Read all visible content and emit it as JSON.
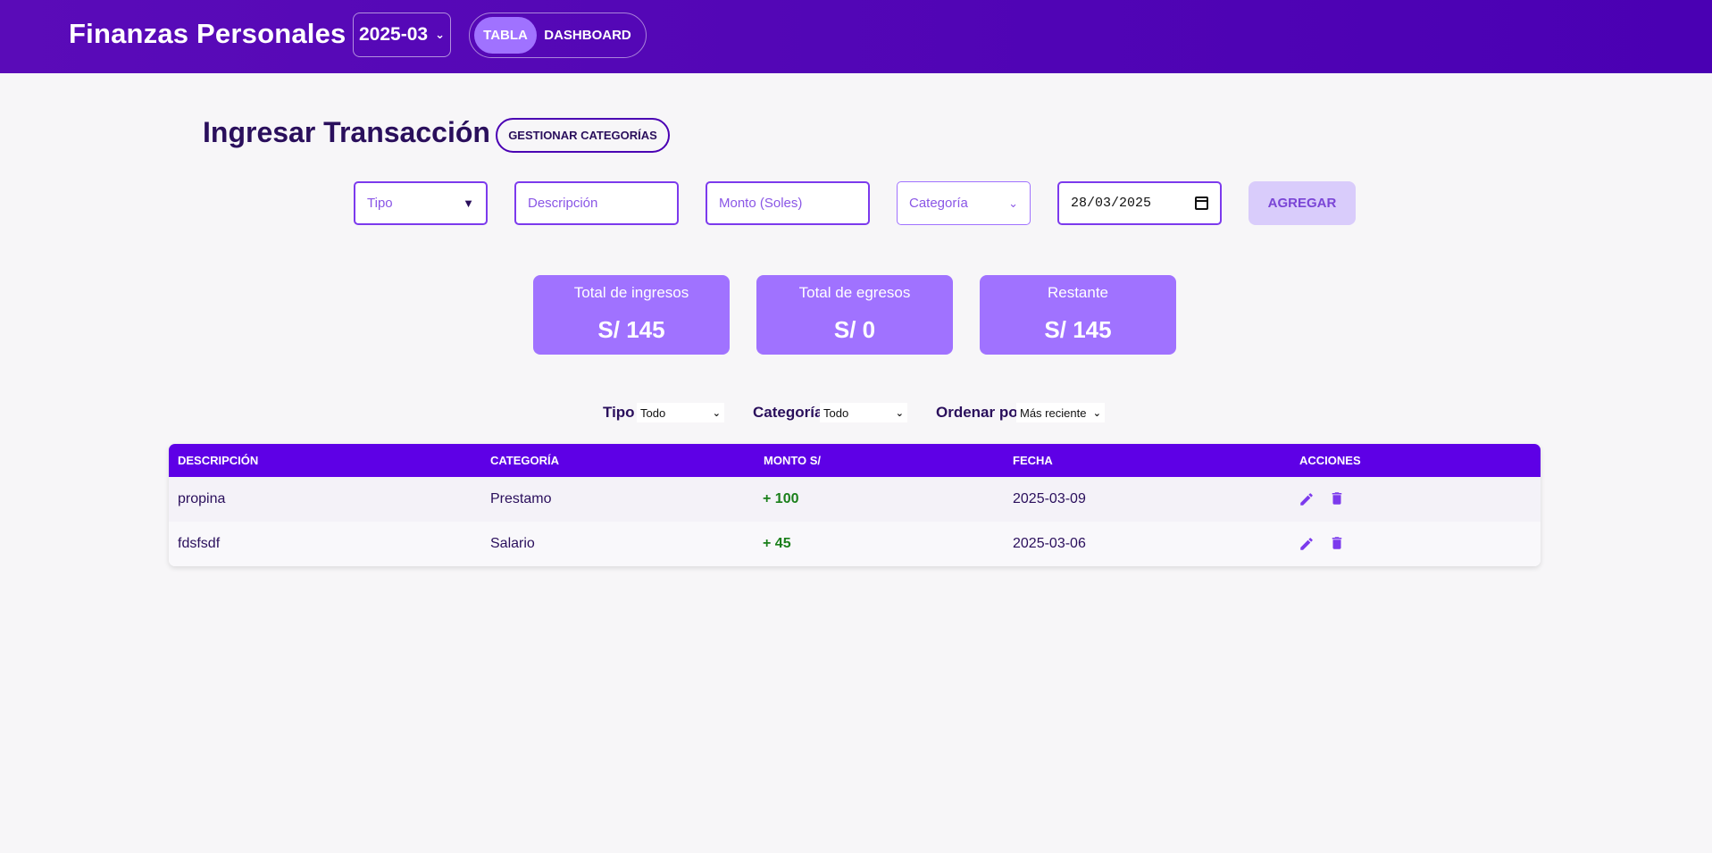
{
  "header": {
    "title": "Finanzas Personales",
    "month": "2025-03",
    "tabs": [
      {
        "label": "TABLA",
        "active": true
      },
      {
        "label": "DASHBOARD",
        "active": false
      }
    ]
  },
  "form": {
    "title": "Ingresar Transacción",
    "manage_categories_label": "GESTIONAR CATEGORÍAS",
    "type_placeholder": "Tipo",
    "description_placeholder": "Descripción",
    "amount_placeholder": "Monto (Soles)",
    "category_placeholder": "Categoría",
    "date_value": "28/03/2025",
    "add_label": "AGREGAR"
  },
  "summary": [
    {
      "label": "Total de ingresos",
      "value": "S/ 145"
    },
    {
      "label": "Total de egresos",
      "value": "S/ 0"
    },
    {
      "label": "Restante",
      "value": "S/ 145"
    }
  ],
  "filters": {
    "type_label": "Tipo",
    "type_value": "Todo",
    "category_label": "Categoría",
    "category_value": "Todo",
    "order_label": "Ordenar por",
    "order_value": "Más reciente"
  },
  "table": {
    "columns": [
      "DESCRIPCIÓN",
      "CATEGORÍA",
      "MONTO S/",
      "FECHA",
      "ACCIONES"
    ],
    "rows": [
      {
        "description": "propina",
        "category": "Prestamo",
        "amount": "+ 100",
        "date": "2025-03-09"
      },
      {
        "description": "fdsfsdf",
        "category": "Salario",
        "amount": "+ 45",
        "date": "2025-03-06"
      }
    ]
  },
  "colors": {
    "header_bg": "#5a0bb8",
    "accent": "#7c3aed",
    "card_bg": "#a072ff",
    "table_header_bg": "#5e00e6",
    "income_text": "#1a7f1a"
  },
  "icons": {
    "edit": "pencil-icon",
    "delete": "trash-icon",
    "calendar": "calendar-icon",
    "dropdown": "chevron-down-icon"
  }
}
